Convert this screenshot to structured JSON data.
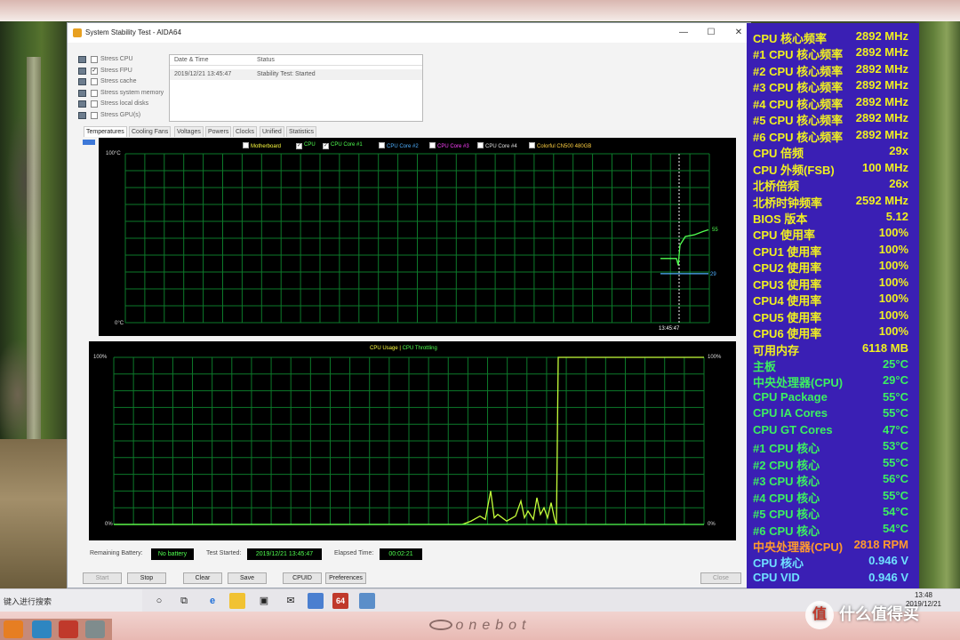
{
  "window": {
    "title": "System Stability Test - AIDA64",
    "controls": {
      "minimize": "—",
      "maximize": "☐",
      "close": "✕"
    }
  },
  "stress_options": [
    {
      "label": "Stress CPU",
      "checked": false
    },
    {
      "label": "Stress FPU",
      "checked": true
    },
    {
      "label": "Stress cache",
      "checked": false
    },
    {
      "label": "Stress system memory",
      "checked": false
    },
    {
      "label": "Stress local disks",
      "checked": false
    },
    {
      "label": "Stress GPU(s)",
      "checked": false
    }
  ],
  "status_table": {
    "headers": [
      "Date & Time",
      "Status"
    ],
    "rows": [
      [
        "2019/12/21 13:45:47",
        "Stability Test: Started"
      ]
    ]
  },
  "tabs": [
    "Temperatures",
    "Cooling Fans",
    "Voltages",
    "Powers",
    "Clocks",
    "Unified",
    "Statistics"
  ],
  "active_tab": "Temperatures",
  "temp_graph": {
    "legend": [
      {
        "label": "Motherboard",
        "checked": false,
        "color": "#ffff40"
      },
      {
        "label": "CPU",
        "checked": true,
        "color": "#50ff50"
      },
      {
        "label": "CPU Core #1",
        "checked": true,
        "color": "#50ff50"
      },
      {
        "label": "CPU Core #2",
        "checked": false,
        "color": "#4fb0ff"
      },
      {
        "label": "CPU Core #3",
        "checked": false,
        "color": "#ff40ff"
      },
      {
        "label": "CPU Core #4",
        "checked": false,
        "color": "#e0e0e0"
      },
      {
        "label": "Colorful CN500 480GB",
        "checked": false,
        "color": "#ffd040"
      }
    ],
    "y_top": "100°C",
    "y_bottom": "0°C",
    "x_marker": "13:45:47",
    "value_high": "55",
    "value_low": "29"
  },
  "usage_graph": {
    "legend_a": "CPU Usage",
    "legend_sep": "|",
    "legend_b": "CPU Throttling",
    "y_top": "100%",
    "y_bottom": "0%",
    "right_top": "100%",
    "right_bottom": "0%"
  },
  "info": {
    "remaining_battery_label": "Remaining Battery:",
    "remaining_battery_value": "No battery",
    "test_started_label": "Test Started:",
    "test_started_value": "2019/12/21 13:45:47",
    "elapsed_label": "Elapsed Time:",
    "elapsed_value": "00:02:21"
  },
  "buttons": {
    "start": "Start",
    "stop": "Stop",
    "clear": "Clear",
    "save": "Save",
    "cpuid": "CPUID",
    "preferences": "Preferences",
    "close": "Close"
  },
  "osd": [
    {
      "k": "CPU 核心频率",
      "v": "2892 MHz",
      "color": "#f0f020"
    },
    {
      "k": "#1 CPU 核心频率",
      "v": "2892 MHz",
      "color": "#f0f020"
    },
    {
      "k": "#2 CPU 核心频率",
      "v": "2892 MHz",
      "color": "#f0f020"
    },
    {
      "k": "#3 CPU 核心频率",
      "v": "2892 MHz",
      "color": "#f0f020"
    },
    {
      "k": "#4 CPU 核心频率",
      "v": "2892 MHz",
      "color": "#f0f020"
    },
    {
      "k": "#5 CPU 核心频率",
      "v": "2892 MHz",
      "color": "#f0f020"
    },
    {
      "k": "#6 CPU 核心频率",
      "v": "2892 MHz",
      "color": "#f0f020"
    },
    {
      "k": "CPU 倍频",
      "v": "29x",
      "color": "#f0f020"
    },
    {
      "k": "CPU 外频(FSB)",
      "v": "100 MHz",
      "color": "#f0f020"
    },
    {
      "k": "北桥倍频",
      "v": "26x",
      "color": "#f0f020"
    },
    {
      "k": "北桥时钟频率",
      "v": "2592 MHz",
      "color": "#f0f020"
    },
    {
      "k": "BIOS 版本",
      "v": "5.12",
      "color": "#f0f020"
    },
    {
      "k": "CPU 使用率",
      "v": "100%",
      "color": "#f0f020"
    },
    {
      "k": "CPU1 使用率",
      "v": "100%",
      "color": "#f0f020"
    },
    {
      "k": "CPU2 使用率",
      "v": "100%",
      "color": "#f0f020"
    },
    {
      "k": "CPU3 使用率",
      "v": "100%",
      "color": "#f0f020"
    },
    {
      "k": "CPU4 使用率",
      "v": "100%",
      "color": "#f0f020"
    },
    {
      "k": "CPU5 使用率",
      "v": "100%",
      "color": "#f0f020"
    },
    {
      "k": "CPU6 使用率",
      "v": "100%",
      "color": "#f0f020"
    },
    {
      "k": "可用内存",
      "v": "6118 MB",
      "color": "#f0f020"
    },
    {
      "k": "主板",
      "v": "25°C",
      "color": "#3cf060"
    },
    {
      "k": "中央处理器(CPU)",
      "v": "29°C",
      "color": "#3cf060"
    },
    {
      "k": "CPU Package",
      "v": "55°C",
      "color": "#3cf060"
    },
    {
      "k": "CPU IA Cores",
      "v": "55°C",
      "color": "#3cf060"
    },
    {
      "k": "CPU GT Cores",
      "v": "47°C",
      "color": "#3cf060"
    },
    {
      "k": "#1 CPU 核心",
      "v": "53°C",
      "color": "#3cf060"
    },
    {
      "k": "#2 CPU 核心",
      "v": "55°C",
      "color": "#3cf060"
    },
    {
      "k": "#3 CPU 核心",
      "v": "56°C",
      "color": "#3cf060"
    },
    {
      "k": "#4 CPU 核心",
      "v": "55°C",
      "color": "#3cf060"
    },
    {
      "k": "#5 CPU 核心",
      "v": "54°C",
      "color": "#3cf060"
    },
    {
      "k": "#6 CPU 核心",
      "v": "54°C",
      "color": "#3cf060"
    },
    {
      "k": "中央处理器(CPU)",
      "v": "2818 RPM",
      "color": "#ff9a2e"
    },
    {
      "k": "CPU 核心",
      "v": "0.946 V",
      "color": "#6fe0ff"
    },
    {
      "k": "CPU VID",
      "v": "0.946 V",
      "color": "#6fe0ff"
    }
  ],
  "taskbar": {
    "search_text": "键入进行搜索",
    "time": "13:48",
    "date": "2019/12/21",
    "app_64": "64"
  },
  "brand": {
    "bezel": "onebot",
    "watermark_badge": "值",
    "watermark": "什么值得买"
  }
}
